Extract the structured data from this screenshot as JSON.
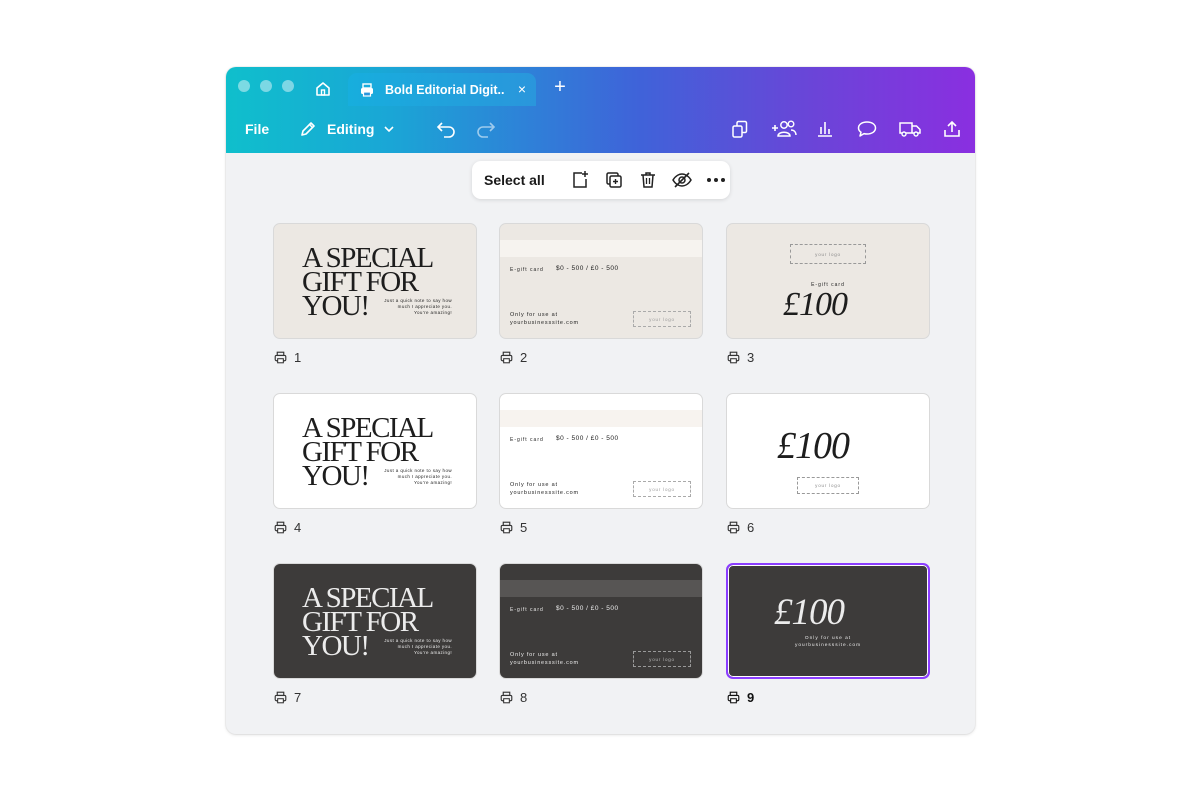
{
  "app": {
    "tab_title": "Bold Editorial Digit...",
    "new_tab_symbol": "+",
    "close_symbol": "×"
  },
  "toolbar": {
    "file_label": "File",
    "editing_label": "Editing"
  },
  "actionbar": {
    "select_all_label": "Select all"
  },
  "pages": [
    {
      "number": "1",
      "theme": "beige",
      "layout": "title",
      "title": "A SPECIAL GIFT FOR YOU!",
      "note": "Just a quick note to say how much I appreciate you. You're amazing!"
    },
    {
      "number": "2",
      "theme": "beige",
      "layout": "details",
      "egift": "E-gift card",
      "price_range": "$0 - 500 / £0 - 500",
      "only_line1": "Only for use at",
      "only_line2": "yourbusinesssite.com",
      "logo": "your logo"
    },
    {
      "number": "3",
      "theme": "beige",
      "layout": "amount-top-logo",
      "logo": "your logo",
      "egift": "E-gift card",
      "amount": "£100"
    },
    {
      "number": "4",
      "theme": "white",
      "layout": "title",
      "title": "A SPECIAL GIFT FOR YOU!",
      "note": "Just a quick note to say how much I appreciate you. You're amazing!"
    },
    {
      "number": "5",
      "theme": "white",
      "layout": "details",
      "egift": "E-gift card",
      "price_range": "$0 - 500 / £0 - 500",
      "only_line1": "Only for use at",
      "only_line2": "yourbusinesssite.com",
      "logo": "your logo"
    },
    {
      "number": "6",
      "theme": "white",
      "layout": "amount-bottom-logo",
      "amount": "£100",
      "logo": "your logo"
    },
    {
      "number": "7",
      "theme": "dark",
      "layout": "title",
      "title": "A SPECIAL GIFT FOR YOU!",
      "note": "Just a quick note to say how much I appreciate you. You're amazing!"
    },
    {
      "number": "8",
      "theme": "dark",
      "layout": "details",
      "egift": "E-gift card",
      "price_range": "$0 - 500 / £0 - 500",
      "only_line1": "Only for use at",
      "only_line2": "yourbusinesssite.com",
      "logo": "your logo"
    },
    {
      "number": "9",
      "theme": "dark",
      "layout": "amount-only",
      "amount": "£100",
      "only_line1": "Only for use at",
      "only_line2": "yourbusinesssite.com",
      "selected": true
    }
  ],
  "colors": {
    "accent_selected": "#8b3dff",
    "beige_card": "#ece8e3",
    "dark_card": "#3d3b3a",
    "canvas_bg": "#f1f2f4"
  },
  "icons": [
    "home-icon",
    "printer-icon",
    "close-icon",
    "plus-icon",
    "pencil-icon",
    "chevron-down-icon",
    "undo-icon",
    "redo-icon",
    "copy-pages-icon",
    "share-people-icon",
    "insights-chart-icon",
    "comment-icon",
    "delivery-truck-icon",
    "upload-share-icon",
    "add-page-icon",
    "duplicate-page-icon",
    "trash-icon",
    "hide-eye-icon",
    "more-icon"
  ]
}
